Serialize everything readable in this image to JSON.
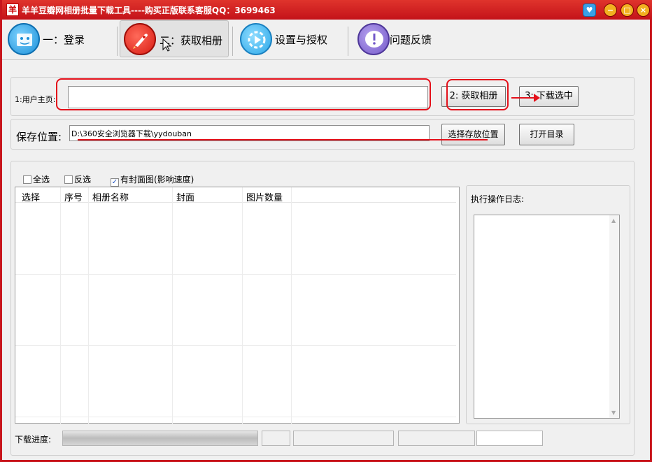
{
  "window": {
    "title": "羊羊豆瓣网相册批量下载工具----购买正版联系客服QQ：3699463",
    "app_icon_glyph": "羊"
  },
  "titlebar_buttons": {
    "minimize": "−",
    "maximize": "□",
    "close": "×",
    "skin": "♥"
  },
  "nav": [
    {
      "label": "一：登录",
      "icon": "finder-face-icon"
    },
    {
      "label": "二：获取相册",
      "icon": "rocket-icon",
      "active": true
    },
    {
      "label": "设置与授权",
      "icon": "play-settings-icon"
    },
    {
      "label": "问题反馈",
      "icon": "exclamation-icon"
    }
  ],
  "form": {
    "user_home_label": "1:用户主页:",
    "user_home_value": "",
    "get_album_btn": "2: 获取相册",
    "download_selected_btn": "3: 下载选中",
    "save_location_label": "保存位置:",
    "save_location_value": "D:\\360安全浏览器下载\\yydouban",
    "choose_folder_btn": "选择存放位置",
    "open_dir_btn": "打开目录"
  },
  "options": {
    "select_all": "全选",
    "invert": "反选",
    "with_cover": "有封面图(影响速度)",
    "with_cover_checked": true
  },
  "table": {
    "columns": [
      "选择",
      "序号",
      "相册名称",
      "封面",
      "图片数量"
    ],
    "rows": []
  },
  "log": {
    "label": "执行操作日志:",
    "content": ""
  },
  "progress": {
    "label": "下载进度:",
    "value": 1.0,
    "fields": [
      "",
      "",
      "",
      ""
    ]
  },
  "colors": {
    "title_red": "#c31219",
    "annotation_red": "#e4101a"
  }
}
